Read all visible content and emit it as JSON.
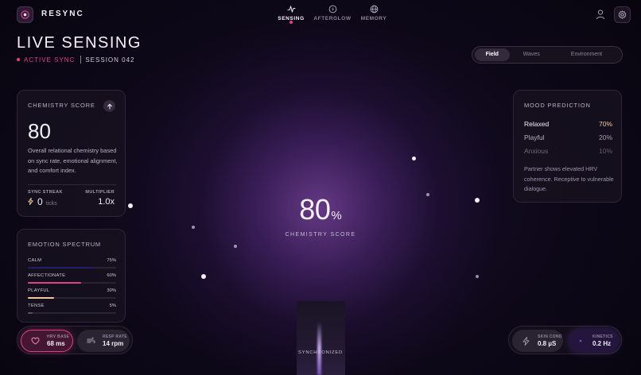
{
  "app": {
    "brand": "RESYNC"
  },
  "nav": [
    {
      "id": "sensing",
      "label": "SENSING",
      "icon": "pulse-icon",
      "active": true
    },
    {
      "id": "afterglow",
      "label": "AFTERGLOW",
      "icon": "circle-bolt-icon",
      "active": false
    },
    {
      "id": "memory",
      "label": "MEMORY",
      "icon": "globe-icon",
      "active": false
    }
  ],
  "header": {
    "title": "LIVE SENSING",
    "status": "ACTIVE SYNC",
    "session": "SESSION 042"
  },
  "view_toggle": {
    "options": [
      "Field",
      "Waves",
      "Environment"
    ],
    "selected": "Field"
  },
  "chemistry_card": {
    "title": "CHEMISTRY SCORE",
    "value": "80",
    "description": "Overall relational chemistry based on sync rate, emotional alignment, and comfort index.",
    "streak_label": "SYNC STREAK",
    "streak_value": "0",
    "streak_unit": "ticks",
    "multiplier_label": "MULTIPLIER",
    "multiplier_value": "1.0x"
  },
  "emotion_spectrum": {
    "title": "EMOTION SPECTRUM",
    "items": [
      {
        "name": "CALM",
        "pct_label": "75%",
        "value": 0.75,
        "color": "#241d6a"
      },
      {
        "name": "AFFECTIONATE",
        "pct_label": "60%",
        "value": 0.6,
        "color": "#e0408a"
      },
      {
        "name": "PLAYFUL",
        "pct_label": "30%",
        "value": 0.3,
        "color": "#f0c89a"
      },
      {
        "name": "TENSE",
        "pct_label": "5%",
        "value": 0.05,
        "color": "#5a4f66"
      }
    ]
  },
  "mood_prediction": {
    "title": "MOOD PREDICTION",
    "items": [
      {
        "name": "Relaxed",
        "pct": "70%",
        "name_color": "#f3eef8",
        "pct_color": "#f2c89a"
      },
      {
        "name": "Playful",
        "pct": "20%",
        "name_color": "#b9b1c4",
        "pct_color": "#a69eb1"
      },
      {
        "name": "Anxious",
        "pct": "10%",
        "name_color": "#6f6879",
        "pct_color": "#615a6b"
      }
    ],
    "note": "Partner shows elevated HRV coherence. Receptive to vulnerable dialogue."
  },
  "center": {
    "value": "80",
    "unit": "%",
    "label": "CHEMISTRY SCORE",
    "sync_label": "SYNCHRONIZED"
  },
  "metrics_left": [
    {
      "label": "HRV BASE",
      "value": "68 ms",
      "icon": "heart-icon",
      "highlight": true
    },
    {
      "label": "RESP RATE",
      "value": "14 rpm",
      "icon": "wind-icon",
      "highlight": false
    }
  ],
  "metrics_right": [
    {
      "label": "SKIN COND",
      "value": "0.8 µS",
      "icon": "bolt-icon",
      "highlight": false
    },
    {
      "label": "KINETICS",
      "value": "0.2 Hz",
      "icon": "motion-icon",
      "highlight": true
    }
  ],
  "colors": {
    "accent": "#e0408a",
    "warm": "#f2c89a",
    "background": "#0d0818"
  }
}
